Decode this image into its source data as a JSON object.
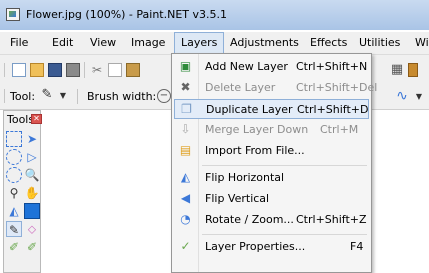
{
  "window": {
    "title": "Flower.jpg (100%) - Paint.NET v3.5.1"
  },
  "menubar": {
    "items": [
      {
        "label": "File"
      },
      {
        "label": "Edit"
      },
      {
        "label": "View"
      },
      {
        "label": "Image"
      },
      {
        "label": "Layers"
      },
      {
        "label": "Adjustments"
      },
      {
        "label": "Effects"
      },
      {
        "label": "Utilities"
      },
      {
        "label": "Wi"
      }
    ]
  },
  "toolbar": {
    "tool_label": "Tool:",
    "brush_label": "Brush width:"
  },
  "tools_panel": {
    "title": "Tools"
  },
  "layers_menu": {
    "items": [
      {
        "label": "Add New Layer",
        "shortcut": "Ctrl+Shift+N",
        "icon": "add-layer-icon"
      },
      {
        "label": "Delete Layer",
        "shortcut": "Ctrl+Shift+Del",
        "icon": "delete-layer-icon"
      },
      {
        "label": "Duplicate Layer",
        "shortcut": "Ctrl+Shift+D",
        "icon": "duplicate-layer-icon"
      },
      {
        "label": "Merge Layer Down",
        "shortcut": "Ctrl+M",
        "icon": "merge-layer-icon"
      },
      {
        "label": "Import From File...",
        "shortcut": "",
        "icon": "import-file-icon"
      },
      {
        "label": "Flip Horizontal",
        "shortcut": "",
        "icon": "flip-horizontal-icon"
      },
      {
        "label": "Flip Vertical",
        "shortcut": "",
        "icon": "flip-vertical-icon"
      },
      {
        "label": "Rotate / Zoom...",
        "shortcut": "Ctrl+Shift+Z",
        "icon": "rotate-zoom-icon"
      },
      {
        "label": "Layer Properties...",
        "shortcut": "F4",
        "icon": "layer-properties-icon"
      }
    ]
  },
  "colors": {
    "highlight": "#e3ecf8",
    "highlight_border": "#8fb0d8",
    "disabled_text": "#8d8d8d"
  }
}
